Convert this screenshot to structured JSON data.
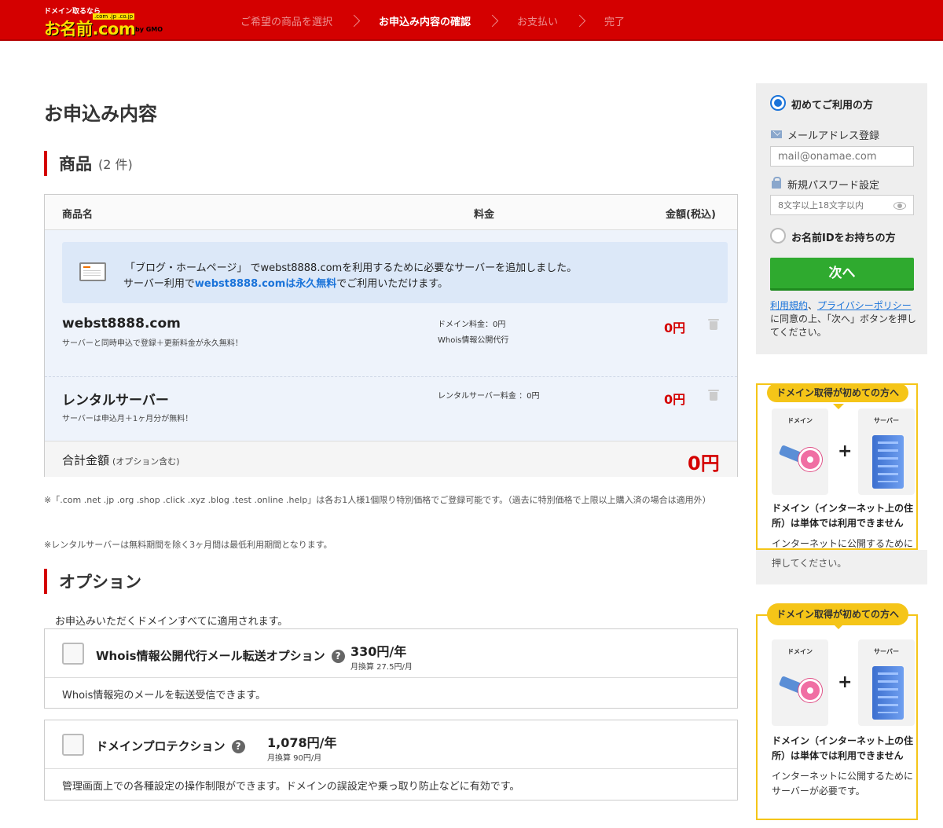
{
  "header": {
    "logo_tag": "ドメイン取るなら",
    "logo_tlds": ".com .jp .co.jp",
    "logo_name": "お名前.com",
    "logo_gmo": "by GMO",
    "steps": [
      {
        "label": "ご希望の商品を選択",
        "current": false
      },
      {
        "label": "お申込み内容の確認",
        "current": true
      },
      {
        "label": "お支払い",
        "current": false
      },
      {
        "label": "完了",
        "current": false
      }
    ]
  },
  "page_title": "お申込み内容",
  "products_section": {
    "title": "商品",
    "count": "(2 件)",
    "columns": {
      "name": "商品名",
      "fee": "料金",
      "amount": "金額(税込)"
    },
    "notice": {
      "prefix": "「ブログ・ホームページ」 でwebst8888.comを利用するために必要なサーバーを追加しました。",
      "line2_a": "サーバー利用で",
      "line2_hl": "webst8888.comは永久無料",
      "line2_b": "でご利用いただけます。"
    },
    "items": [
      {
        "name": "webst8888.com",
        "desc": "サーバーと同時申込で登録＋更新料金が永久無料！",
        "fee1": "ドメイン料金：0円",
        "fee2": "Whois情報公開代行",
        "price": "0円"
      },
      {
        "name": "レンタルサーバー",
        "desc": "サーバーは申込月＋1ヶ月分が無料！",
        "fee1": "レンタルサーバー料金 ：0円",
        "fee2": "",
        "price": "0円"
      }
    ],
    "total_label": "合計金額",
    "total_sub": "(オプション含む)",
    "total_amount": "0円"
  },
  "notes": {
    "note1": "※「.com .net .jp .org .shop .click .xyz .blog .test .online .help」は各お1人様1個限り特別価格でご登録可能です。（過去に特別価格で上限以上購入済の場合は適用外）",
    "note2": "※レンタルサーバーは無料期間を除く3ヶ月間は最低利用期間となります。"
  },
  "options_section": {
    "title": "オプション",
    "intro": "お申込みいただくドメインすべてに適用されます。",
    "options": [
      {
        "name": "Whois情報公開代行メール転送オプション",
        "price": "330円/年",
        "monthly": "月換算 27.5円/月",
        "desc": "Whois情報宛のメールを転送受信できます。",
        "checked": false
      },
      {
        "name": "ドメインプロテクション",
        "price": "1,078円/年",
        "monthly": "月換算 90円/月",
        "desc": "管理画面上での各種設定の操作制限ができます。ドメインの誤設定や乗っ取り防止などに有効です。",
        "checked": false
      }
    ]
  },
  "login": {
    "first_time_label": "初めてご利用の方",
    "first_time_selected": true,
    "email_label": "メールアドレス登録",
    "email_placeholder": "mail@onamae.com",
    "password_label": "新規パスワード設定",
    "password_placeholder": "8文字以上18文字以内",
    "have_id_label": "お名前IDをお持ちの方",
    "have_id_selected": false,
    "next_button": "次へ",
    "terms_link1": "利用規約",
    "terms_sep": "、",
    "terms_link2": "プライバシーポリシー",
    "terms_text": "に同意の上、「次へ」ボタンを押してください。"
  },
  "promo": {
    "header": "ドメイン取得が初めての方へ",
    "card_domain": "ドメイン",
    "card_server": "サーバー",
    "title": "ドメイン（インターネット上の住所）は単体では利用できません",
    "desc": "インターネットに公開するためにサーバーが必要です。"
  },
  "overlap_text": "押してください。",
  "colors": {
    "brand_red": "#d40000",
    "accent_blue": "#1a73d9",
    "button_green": "#2faa2f",
    "promo_yellow": "#f5c518"
  }
}
